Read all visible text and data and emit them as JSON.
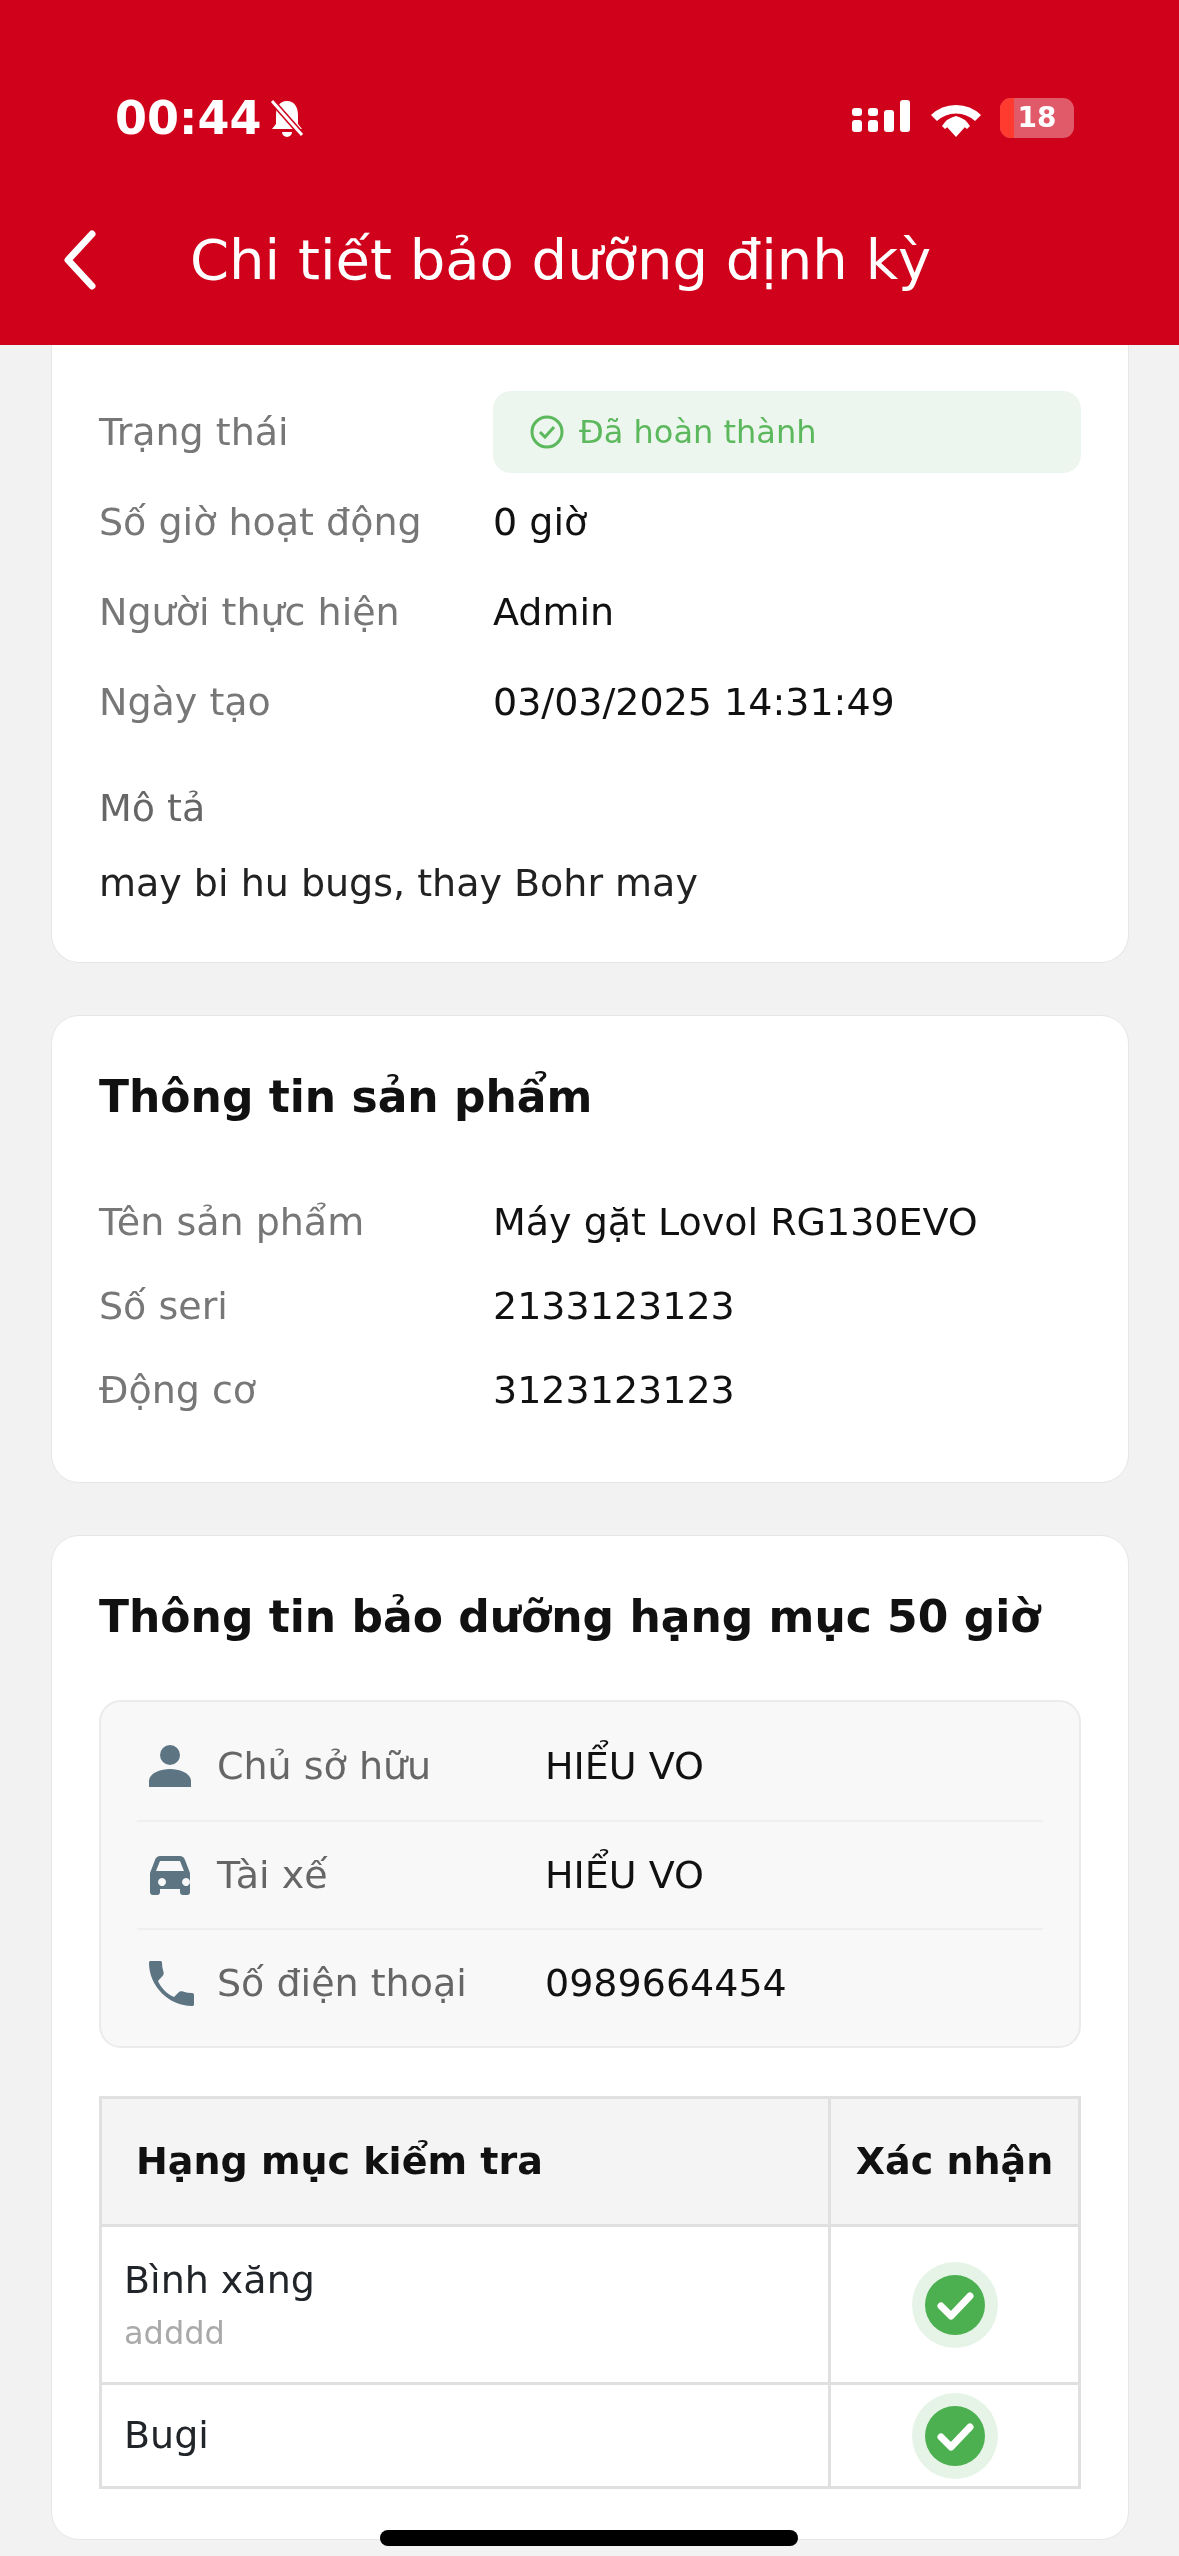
{
  "status_bar": {
    "time": "00:44",
    "silent": true,
    "battery": "18"
  },
  "header": {
    "title": "Chi tiết bảo dưỡng định kỳ"
  },
  "request_card": {
    "rows": [
      {
        "kind": "status",
        "label": "Trạng thái",
        "value": "Đã hoàn thành"
      },
      {
        "kind": "text",
        "label": "Số giờ hoạt động",
        "value": "0 giờ"
      },
      {
        "kind": "text",
        "label": "Người thực hiện",
        "value": "Admin"
      },
      {
        "kind": "text",
        "label": "Ngày tạo",
        "value": "03/03/2025 14:31:49"
      }
    ],
    "description_label": "Mô tả",
    "description": "may bi hu bugs, thay Bohr may"
  },
  "product_card": {
    "title": "Thông tin sản phẩm",
    "rows": [
      {
        "label": "Tên sản phẩm",
        "value": "Máy gặt Lovol RG130EVO"
      },
      {
        "label": "Số seri",
        "value": "2133123123"
      },
      {
        "label": "Động cơ",
        "value": "3123123123"
      }
    ]
  },
  "maintenance_card": {
    "title": "Thông tin bảo dưỡng hạng mục 50 giờ",
    "contacts": [
      {
        "kind": "person",
        "label": "Chủ sở hữu",
        "value": "HIỂU VO"
      },
      {
        "kind": "car",
        "label": "Tài xế",
        "value": "HIỂU VO"
      },
      {
        "kind": "phone",
        "label": "Số điện thoại",
        "value": "0989664454"
      }
    ],
    "table": {
      "columns": [
        "Hạng mục kiểm tra",
        "Xác nhận"
      ],
      "rows": [
        {
          "item": "Bình xăng",
          "note": "adddd",
          "confirmed": true
        },
        {
          "item": "Bugi",
          "confirmed": true
        }
      ]
    }
  }
}
